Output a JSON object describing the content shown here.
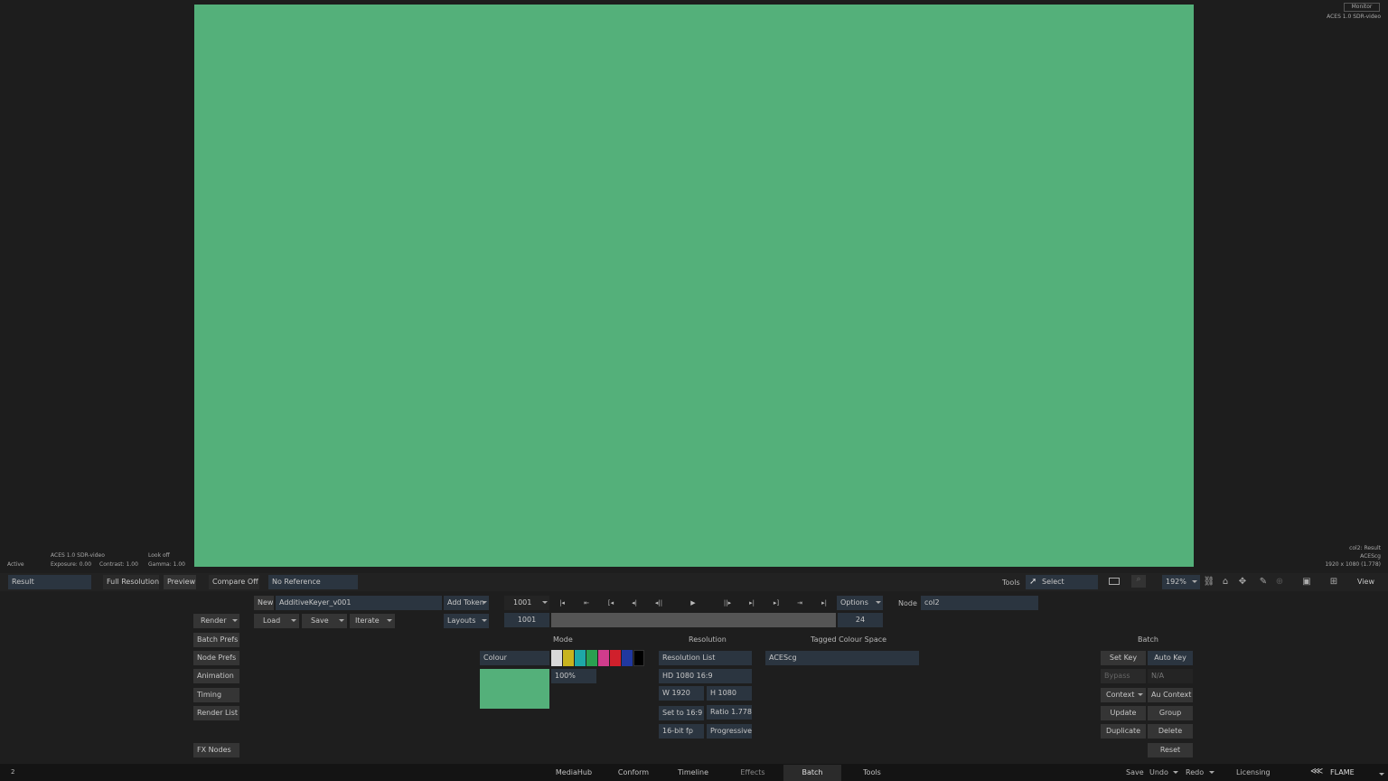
{
  "viewer": {
    "monitor_label": "Monitor",
    "monitor_cs": "ACES 1.0 SDR-video",
    "status": "Active",
    "view_cs": "ACES 1.0 SDR-video",
    "look": "Look off",
    "exposure": "Exposure: 0.00",
    "contrast": "Contrast: 1.00",
    "gamma": "Gamma: 1.00",
    "node_result": "col2: Result",
    "node_cs": "ACEScg",
    "node_res": "1920 x 1080 (1.778)",
    "canvas_color": "#54b07a"
  },
  "viewer_bar": {
    "result": "Result",
    "full_res": "Full Resolution",
    "preview": "Preview",
    "compare": "Compare Off",
    "reference": "No Reference",
    "tools": "Tools",
    "select": "Select",
    "zoom": "192%",
    "view": "View"
  },
  "batch_bar": {
    "new": "New",
    "name": "AdditiveKeyer_v001",
    "add_token": "Add Token",
    "frame": "1001",
    "options": "Options",
    "node_label": "Node",
    "node_value": "col2",
    "load": "Load",
    "save": "Save",
    "iterate": "Iterate",
    "layouts": "Layouts",
    "start_frame": "1001",
    "end_frame": "24"
  },
  "left_buttons": {
    "render": "Render",
    "batch_prefs": "Batch Prefs",
    "node_prefs": "Node Prefs",
    "animation": "Animation",
    "timing": "Timing",
    "render_list": "Render List",
    "fx_nodes": "FX Nodes"
  },
  "mode": {
    "title": "Mode",
    "value": "Colour",
    "percent": "100%",
    "preview_color": "#54b07a",
    "swatches": [
      "#d8d8d8",
      "#c8b41e",
      "#1ea8a8",
      "#2aa050",
      "#d03c8c",
      "#d0202c",
      "#2038a0",
      "#000000"
    ]
  },
  "resolution": {
    "title": "Resolution",
    "list": "Resolution List",
    "preset": "HD 1080 16:9",
    "w": "W 1920",
    "h": "H 1080",
    "set_ratio": "Set to 16:9",
    "ratio": "Ratio 1.778",
    "depth": "16-bit fp",
    "scan": "Progressive"
  },
  "colour_space": {
    "title": "Tagged Colour Space",
    "value": "ACEScg"
  },
  "batch_panel": {
    "title": "Batch",
    "set_key": "Set Key",
    "auto_key": "Auto Key",
    "bypass": "Bypass",
    "na": "N/A",
    "context": "Context",
    "au_context": "Au Context",
    "update": "Update",
    "group": "Group",
    "duplicate": "Duplicate",
    "delete": "Delete",
    "reset": "Reset"
  },
  "tabs": [
    "MediaHub",
    "Conform",
    "Timeline",
    "Effects",
    "Batch",
    "Tools"
  ],
  "status_bar": {
    "left_indicator": "2",
    "save": "Save",
    "undo": "Undo",
    "redo": "Redo",
    "licensing": "Licensing",
    "app": "FLAME"
  }
}
